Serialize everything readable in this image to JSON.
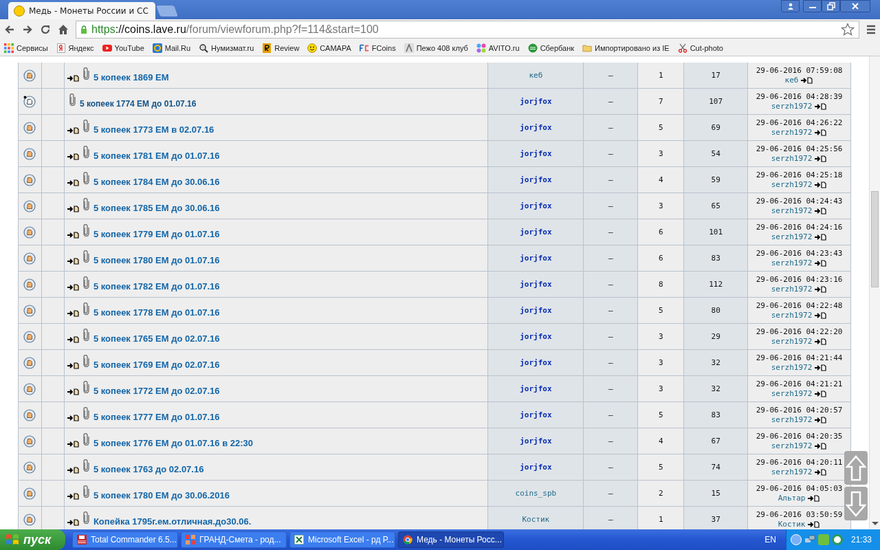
{
  "browser": {
    "tab_title": "Медь - Монеты России и СС",
    "url": {
      "scheme": "https",
      "host": "://coins.lave.ru",
      "path": "/forum/viewforum.php?f=114&start=100"
    },
    "bookmarks": [
      {
        "label": "Сервисы",
        "kind": "apps"
      },
      {
        "label": "Яндекс",
        "kind": "ya"
      },
      {
        "label": "YouTube",
        "kind": "yt"
      },
      {
        "label": "Mail.Ru",
        "kind": "mail"
      },
      {
        "label": "Нумизмат.ru",
        "kind": "search"
      },
      {
        "label": "Review",
        "kind": "r"
      },
      {
        "label": "САМАРА",
        "kind": "smile"
      },
      {
        "label": "FCoins",
        "kind": "fc"
      },
      {
        "label": "Пежо 408 клуб",
        "kind": "car"
      },
      {
        "label": "AVITO.ru",
        "kind": "dots"
      },
      {
        "label": "Сбербанк",
        "kind": "sber"
      },
      {
        "label": "Импортировано из IE",
        "kind": "folder"
      },
      {
        "label": "Cut-photo",
        "kind": "scissors"
      }
    ]
  },
  "topics": [
    {
      "title": "5 копеек 1869 ЕМ",
      "unread": true,
      "author": "кеб",
      "author_bold": false,
      "col_4": "–",
      "replies": "1",
      "views": "17",
      "last_time": "29-06-2016 07:59:08",
      "last_user": "кеб"
    },
    {
      "title": "5 копеек 1774 ЕМ до 01.07.16",
      "unread": false,
      "author": "jorjfox",
      "author_bold": true,
      "col_4": "–",
      "replies": "7",
      "views": "107",
      "last_time": "29-06-2016 04:28:39",
      "last_user": "serzh1972"
    },
    {
      "title": "5 копеек 1773 ЕМ в 02.07.16",
      "unread": true,
      "author": "jorjfox",
      "author_bold": true,
      "col_4": "–",
      "replies": "5",
      "views": "69",
      "last_time": "29-06-2016 04:26:22",
      "last_user": "serzh1972"
    },
    {
      "title": "5 копеек 1781 ЕМ до 01.07.16",
      "unread": true,
      "author": "jorjfox",
      "author_bold": true,
      "col_4": "–",
      "replies": "3",
      "views": "54",
      "last_time": "29-06-2016 04:25:56",
      "last_user": "serzh1972"
    },
    {
      "title": "5 копеек 1784 ЕМ до 30.06.16",
      "unread": true,
      "author": "jorjfox",
      "author_bold": true,
      "col_4": "–",
      "replies": "4",
      "views": "59",
      "last_time": "29-06-2016 04:25:18",
      "last_user": "serzh1972"
    },
    {
      "title": "5 копеек 1785 ЕМ до 30.06.16",
      "unread": true,
      "author": "jorjfox",
      "author_bold": true,
      "col_4": "–",
      "replies": "3",
      "views": "65",
      "last_time": "29-06-2016 04:24:43",
      "last_user": "serzh1972"
    },
    {
      "title": "5 копеек 1779 ЕМ до 01.07.16",
      "unread": true,
      "author": "jorjfox",
      "author_bold": true,
      "col_4": "–",
      "replies": "6",
      "views": "101",
      "last_time": "29-06-2016 04:24:16",
      "last_user": "serzh1972"
    },
    {
      "title": "5 копеек 1780 ЕМ до 01.07.16",
      "unread": true,
      "author": "jorjfox",
      "author_bold": true,
      "col_4": "–",
      "replies": "6",
      "views": "83",
      "last_time": "29-06-2016 04:23:43",
      "last_user": "serzh1972"
    },
    {
      "title": "5 копеек 1782 ЕМ до 01.07.16",
      "unread": true,
      "author": "jorjfox",
      "author_bold": true,
      "col_4": "–",
      "replies": "8",
      "views": "112",
      "last_time": "29-06-2016 04:23:16",
      "last_user": "serzh1972"
    },
    {
      "title": "5 копеек 1778 ЕМ до 01.07.16",
      "unread": true,
      "author": "jorjfox",
      "author_bold": true,
      "col_4": "–",
      "replies": "5",
      "views": "80",
      "last_time": "29-06-2016 04:22:48",
      "last_user": "serzh1972"
    },
    {
      "title": "5 копеек 1765 ЕМ до 02.07.16",
      "unread": true,
      "author": "jorjfox",
      "author_bold": true,
      "col_4": "–",
      "replies": "3",
      "views": "29",
      "last_time": "29-06-2016 04:22:20",
      "last_user": "serzh1972"
    },
    {
      "title": "5 копеек 1769 ЕМ до 02.07.16",
      "unread": true,
      "author": "jorjfox",
      "author_bold": true,
      "col_4": "–",
      "replies": "3",
      "views": "32",
      "last_time": "29-06-2016 04:21:44",
      "last_user": "serzh1972"
    },
    {
      "title": "5 копеек 1772 ЕМ до 02.07.16",
      "unread": true,
      "author": "jorjfox",
      "author_bold": true,
      "col_4": "–",
      "replies": "3",
      "views": "32",
      "last_time": "29-06-2016 04:21:21",
      "last_user": "serzh1972"
    },
    {
      "title": "5 копеек 1777 ЕМ до 01.07.16",
      "unread": true,
      "author": "jorjfox",
      "author_bold": true,
      "col_4": "–",
      "replies": "5",
      "views": "83",
      "last_time": "29-06-2016 04:20:57",
      "last_user": "serzh1972"
    },
    {
      "title": "5 копеек 1776 ЕМ до 01.07.16 в 22:30",
      "unread": true,
      "author": "jorjfox",
      "author_bold": true,
      "col_4": "–",
      "replies": "4",
      "views": "67",
      "last_time": "29-06-2016 04:20:35",
      "last_user": "serzh1972"
    },
    {
      "title": "5 копеек 1763 до 02.07.16",
      "unread": true,
      "author": "jorjfox",
      "author_bold": true,
      "col_4": "–",
      "replies": "5",
      "views": "74",
      "last_time": "29-06-2016 04:20:11",
      "last_user": "serzh1972"
    },
    {
      "title": "5 копеек 1780 ЕМ до 30.06.2016",
      "unread": true,
      "author": "coins_spb",
      "author_bold": false,
      "col_4": "–",
      "replies": "2",
      "views": "15",
      "last_time": "29-06-2016 04:05:03",
      "last_user": "Альтар"
    },
    {
      "title": "Копейка 1795г.ем.отличная.до30.06.",
      "unread": true,
      "author": "Костик",
      "author_bold": false,
      "col_4": "–",
      "replies": "1",
      "views": "37",
      "last_time": "29-06-2016 03:50:59",
      "last_user": "Костик"
    }
  ],
  "taskbar": {
    "start": "пуск",
    "windows": [
      {
        "label": "Total Commander 6.5...",
        "kind": "tc",
        "selected": false
      },
      {
        "label": "ГРАНД-Смета - род...",
        "kind": "grand",
        "selected": false
      },
      {
        "label": "Microsoft Excel - рд Р...",
        "kind": "excel",
        "selected": false
      },
      {
        "label": "Медь - Монеты Росс...",
        "kind": "chrome",
        "selected": true
      }
    ],
    "lang": "EN",
    "clock": "21:33"
  }
}
